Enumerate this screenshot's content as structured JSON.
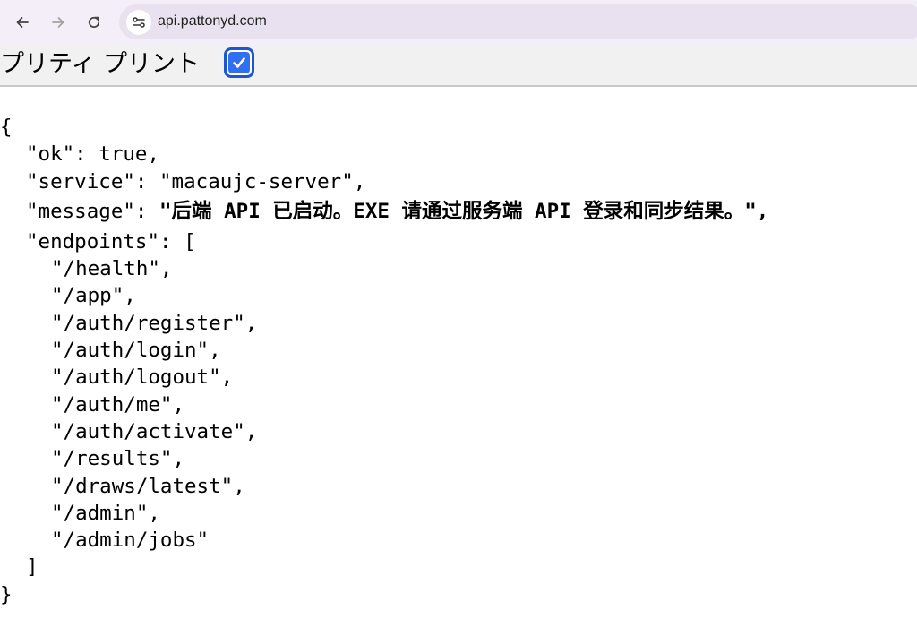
{
  "browser": {
    "url": "api.pattonyd.com",
    "back_icon": "back-arrow-icon",
    "forward_icon": "forward-arrow-icon",
    "reload_icon": "reload-icon",
    "site_info_icon": "site-settings-icon"
  },
  "pretty_print": {
    "label": "プリティ プリント",
    "checked": true,
    "accent": "#2f6ff0"
  },
  "json": {
    "open_brace": "{",
    "close_brace": "}",
    "ok_line": "\"ok\": true,",
    "service_line": "\"service\": \"macaujc-server\",",
    "message_key": "\"message\": ",
    "message_value": "\"后端 API 已启动。EXE 请通过服务端 API 登录和同步结果。\",",
    "endpoints_open": "\"endpoints\": [",
    "endpoints_close": "]",
    "endpoints": [
      "\"/health\",",
      "\"/app\",",
      "\"/auth/register\",",
      "\"/auth/login\",",
      "\"/auth/logout\",",
      "\"/auth/me\",",
      "\"/auth/activate\",",
      "\"/results\",",
      "\"/draws/latest\",",
      "\"/admin\",",
      "\"/admin/jobs\""
    ]
  }
}
